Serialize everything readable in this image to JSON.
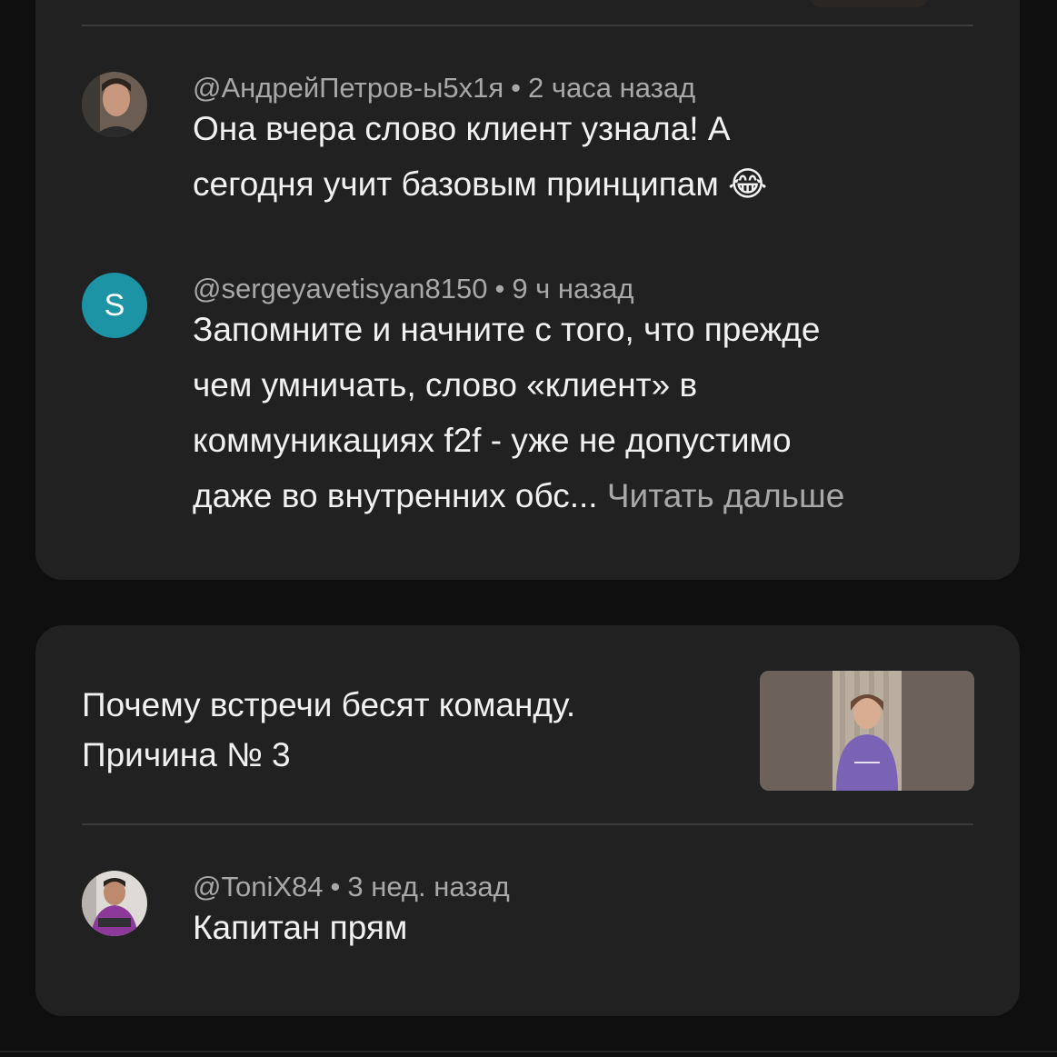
{
  "comments_top": [
    {
      "author": "@АндрейПетров-ы5х1я",
      "time": "2 часа назад",
      "lines": [
        "Она вчера слово  клиент узнала! А",
        "сегодня учит базовым принципам"
      ],
      "emoji": "😂"
    },
    {
      "avatar_letter": "S",
      "author": "@sergeyavetisyan8150",
      "time": "9 ч назад",
      "lines": [
        "Запомните и начните с того, что прежде",
        "чем умничать, слово «клиент» в",
        "коммуникациях f2f - уже не допустимо",
        "даже во внутренних обс..."
      ],
      "read_more": "Читать дальше"
    }
  ],
  "video": {
    "title_lines": [
      "Почему встречи бесят команду.",
      "Причина № 3"
    ],
    "comment": {
      "author": "@ToniX84",
      "time": "3 нед. назад",
      "text": "Капитан прям"
    }
  },
  "separator": "•",
  "colors": {
    "background": "#0f0f0f",
    "card": "#212121",
    "secondary_text": "#a8a8a8",
    "avatar_s": "#1d93a6"
  }
}
